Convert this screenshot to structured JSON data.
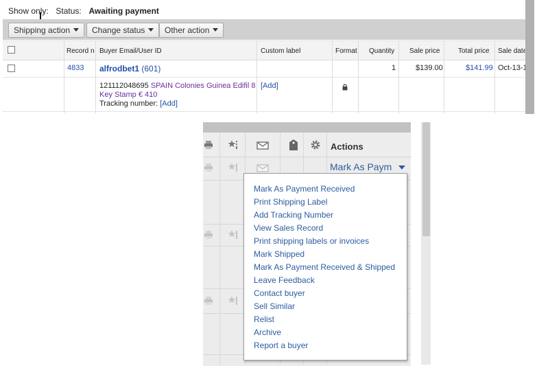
{
  "filter": {
    "show_only_label": "Show only:",
    "status_label": "Status:",
    "status_value": "Awaiting payment"
  },
  "toolbar": {
    "shipping_action": "Shipping action",
    "change_status": "Change status",
    "other_action": "Other action"
  },
  "table": {
    "headers": {
      "record": "Record n",
      "buyer": "Buyer Email/User ID",
      "custom_label": "Custom label",
      "format": "Format",
      "quantity": "Quantity",
      "sale_price": "Sale price",
      "total_price": "Total price",
      "sale_date": "Sale date"
    },
    "row": {
      "record_number": "4833",
      "buyer_id": "alfrodbet1",
      "buyer_feedback": "(601)",
      "quantity": "1",
      "sale_price": "$139.00",
      "total_price": "$141.99",
      "sale_date": "Oct-13-1",
      "item_number": "121112048695",
      "item_title_line1": "SPAIN Colonies Guinea Edifil 8",
      "item_title_line2": "Key Stamp € 410",
      "tracking_label": "Tracking number:",
      "tracking_add": "[Add]",
      "custom_label_add": "[Add]"
    }
  },
  "actions_panel": {
    "header_title": "Actions",
    "mark_as_link": "Mark As Paym",
    "menu_items": [
      "Mark As Payment Received",
      "Print Shipping Label",
      "Add Tracking Number",
      "View Sales Record",
      "Print shipping labels or invoices",
      "Mark Shipped",
      "Mark As Payment Received & Shipped",
      "Leave Feedback",
      "Contact buyer",
      "Sell Similar",
      "Relist",
      "Archive",
      "Report a buyer"
    ],
    "icons": [
      "printer-icon",
      "star-feedback-icon",
      "envelope-icon",
      "shipping-label-icon",
      "gear-icon"
    ]
  },
  "colors": {
    "link": "#2050a8",
    "menu_link": "#2c5c9f",
    "item_title": "#6a2e9e",
    "toolbar_bg": "#d0d0d0"
  }
}
